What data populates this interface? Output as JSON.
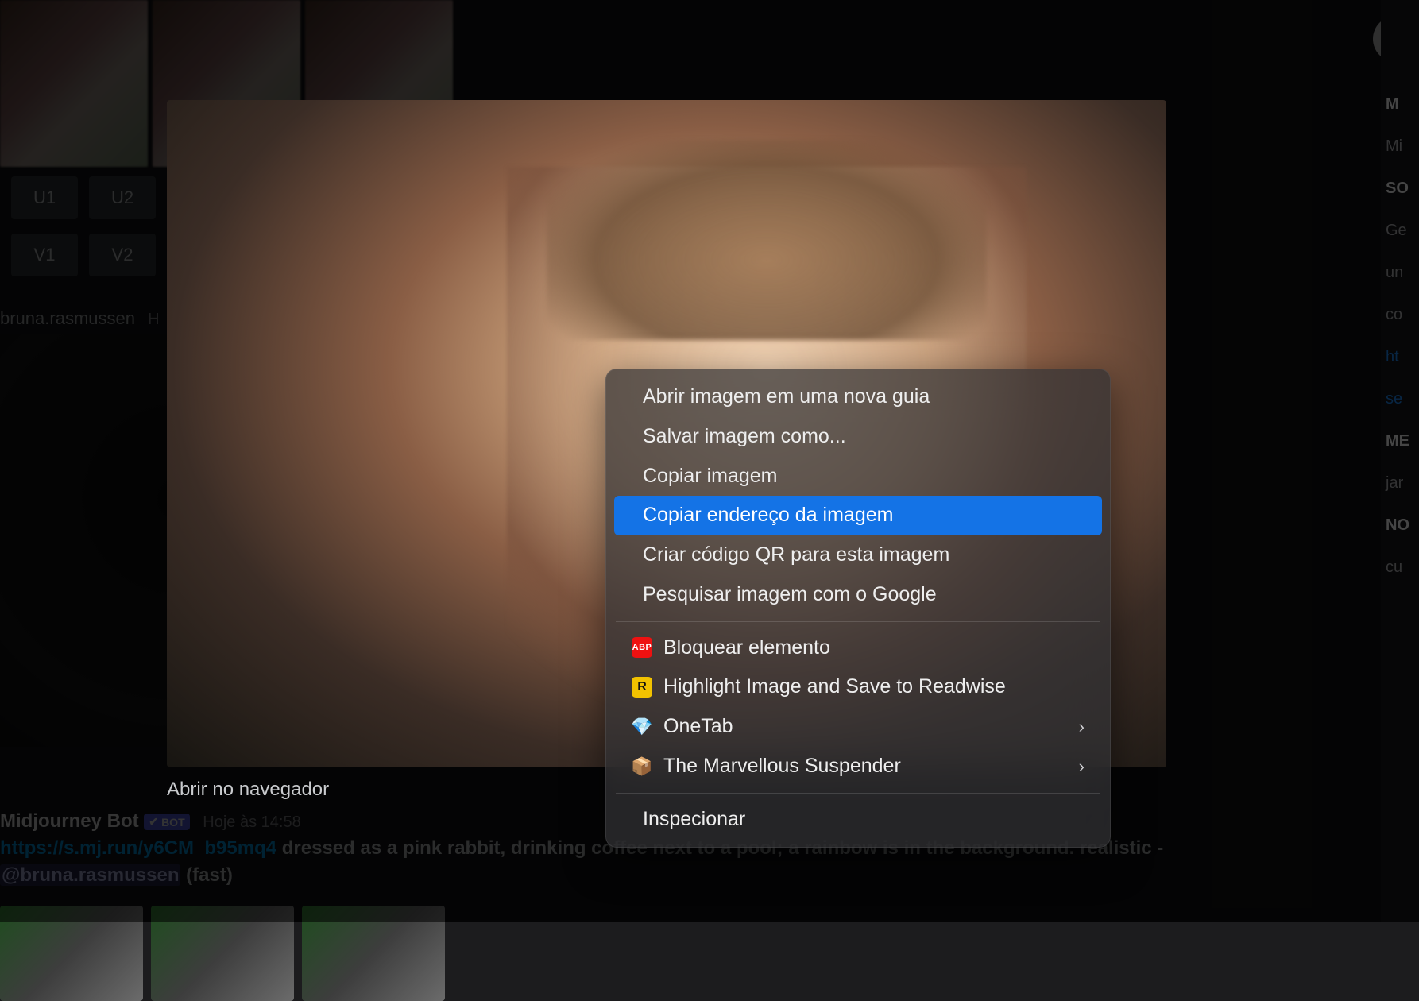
{
  "discord_bg": {
    "buttons_row1": [
      "U1",
      "U2"
    ],
    "buttons_row2": [
      "V1",
      "V2"
    ],
    "reply_user": "bruna.rasmussen",
    "reply_ts_prefix": "H",
    "right": {
      "title": "M",
      "sub": "Mi",
      "h1": "SO",
      "l1": "Ge",
      "l2": "un",
      "l3": "co",
      "link1": "ht",
      "link2": "se",
      "h2": "ME",
      "v2": "jar",
      "h3": "NO",
      "v3": "cu"
    }
  },
  "modal": {
    "open_in_browser": "Abrir no navegador"
  },
  "message": {
    "author": "Midjourney Bot",
    "badge_check": "✔",
    "badge_text": "BOT",
    "ts": "Hoje às 14:58",
    "link": "https://s.mj.run/y6CM_b95mq4",
    "rest": " dressed as a pink rabbit, drinking coffee next to a pool; a rainbow is in the background. realistic -",
    "mention": "@bruna.rasmussen",
    "suffix": " (fast)"
  },
  "context_menu": {
    "items_top": [
      "Abrir imagem em uma nova guia",
      "Salvar imagem como...",
      "Copiar imagem",
      "Copiar endereço da imagem",
      "Criar código QR para esta imagem",
      "Pesquisar imagem com o Google"
    ],
    "highlight_index": 3,
    "ext": {
      "abp": "Bloquear elemento",
      "readwise": "Highlight Image and Save to Readwise",
      "onetab": "OneTab",
      "suspender": "The Marvellous Suspender"
    },
    "inspect": "Inspecionar",
    "icon_labels": {
      "abp": "ABP",
      "readwise": "R",
      "onetab": "💎",
      "suspender": "📦"
    }
  }
}
